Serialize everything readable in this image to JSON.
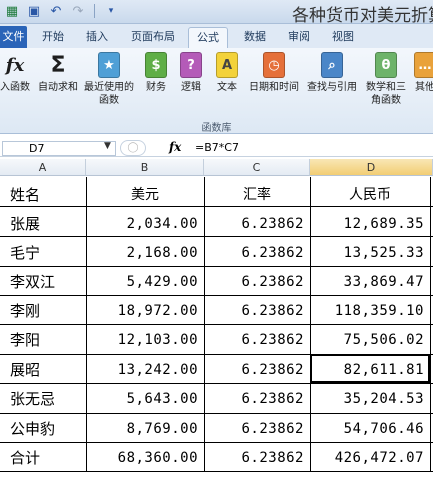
{
  "window": {
    "title": "各种货币对美元折算"
  },
  "tabs": [
    "文件",
    "开始",
    "插入",
    "页面布局",
    "公式",
    "数据",
    "审阅",
    "视图"
  ],
  "ribbon": {
    "insert_function": "入函数",
    "autosum": "自动求和",
    "recent_functions": "最近使用的函数",
    "financial": "财务",
    "logical": "逻辑",
    "text": "文本",
    "datetime": "日期和时间",
    "lookup": "查找与引用",
    "math": "数学和三角函数",
    "more": "其他",
    "group_label": "函数库"
  },
  "formula_bar": {
    "cell_ref": "D7",
    "fx": "fx",
    "formula": "=B7*C7"
  },
  "columns": [
    "A",
    "B",
    "C",
    "D"
  ],
  "table": {
    "headers": [
      "姓名",
      "美元",
      "汇率",
      "人民币"
    ],
    "rows": [
      [
        "张展",
        "2,034.00",
        "6.23862",
        "12,689.35"
      ],
      [
        "毛宁",
        "2,168.00",
        "6.23862",
        "13,525.33"
      ],
      [
        "李双江",
        "5,429.00",
        "6.23862",
        "33,869.47"
      ],
      [
        "李刚",
        "18,972.00",
        "6.23862",
        "118,359.10"
      ],
      [
        "李阳",
        "12,103.00",
        "6.23862",
        "75,506.02"
      ],
      [
        "展昭",
        "13,242.00",
        "6.23862",
        "82,611.81"
      ],
      [
        "张无忌",
        "5,643.00",
        "6.23862",
        "35,204.53"
      ],
      [
        "公申豹",
        "8,769.00",
        "6.23862",
        "54,706.46"
      ],
      [
        "合计",
        "68,360.00",
        "6.23862",
        "426,472.07"
      ]
    ]
  }
}
